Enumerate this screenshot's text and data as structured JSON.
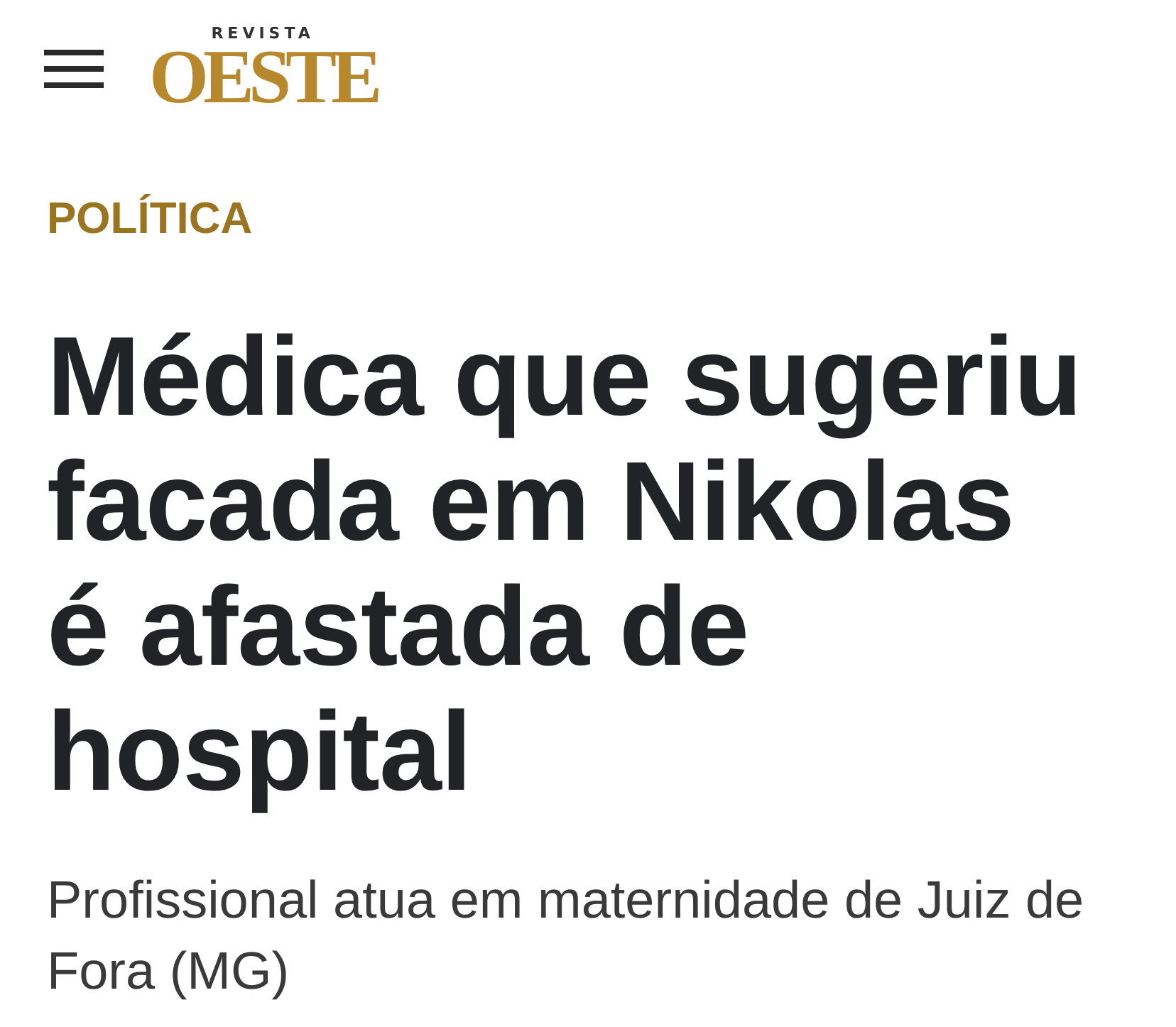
{
  "header": {
    "logo": {
      "overline": "REVISTA",
      "wordmark": "OESTE"
    }
  },
  "article": {
    "section": "POLÍTICA",
    "headline": "Médica que sugeriu facada em Nikolas é afastada de hospital",
    "subtitle": "Profissional atua em maternidade de Juiz de Fora (MG)"
  }
}
